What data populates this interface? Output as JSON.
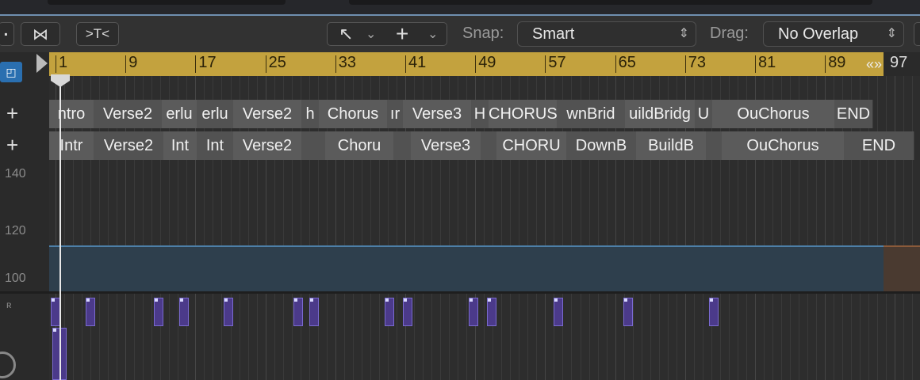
{
  "toolbar": {
    "tool_pointer": "↖",
    "tool_pointer_chev": "⌄",
    "tool_crosshair": "+",
    "tool_crosshair_chev": "⌄",
    "snap_label": "Snap:",
    "snap_value": "Smart",
    "drag_label": "Drag:",
    "drag_value": "No Overlap",
    "btn_catch_glyph": "⋈",
    "btn_collapse_glyph": ">T<"
  },
  "ruler": {
    "bars": [
      "1",
      "9",
      "17",
      "25",
      "33",
      "41",
      "49",
      "57",
      "65",
      "73",
      "81",
      "89",
      "97"
    ],
    "cycle_glyph": "«»"
  },
  "arrangement_top": [
    "ntro",
    "Verse2",
    "erlu",
    "erlu",
    "Verse2",
    "h",
    "Chorus",
    "ır",
    "Verse3",
    "H",
    "CHORUS",
    "wnBrid",
    "uildBridg",
    "U",
    "OuChorus",
    "END"
  ],
  "arrangement_bottom": [
    "Intr",
    "Verse2",
    "Int",
    "Int",
    "Verse2",
    "",
    "Choru",
    "",
    "Verse3",
    "",
    "CHORU",
    "DownB",
    "BuildB",
    "",
    "OuChorus",
    "END"
  ],
  "tempo": {
    "labels": [
      "140",
      "120",
      "100"
    ]
  },
  "colors": {
    "ruler": "#c3a23e",
    "tempo_fill": "#2e3f4d",
    "tempo_line": "#4d7fa8",
    "note": "#4b3a8a"
  },
  "icons": {
    "add": "+"
  }
}
